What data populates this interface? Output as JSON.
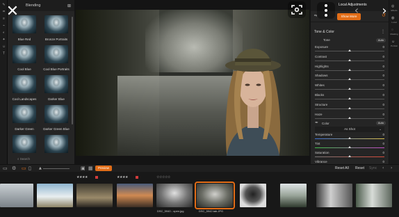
{
  "app": {
    "left_title": "Blending",
    "right_title_tab": "Local Adjustments"
  },
  "presets": [
    {
      "name": "Blue Red"
    },
    {
      "name": "Bronze Portraits"
    },
    {
      "name": "Cool Blue"
    },
    {
      "name": "Cool Blue Portraits"
    },
    {
      "name": "Cool Landscapes"
    },
    {
      "name": "Darker Blue"
    },
    {
      "name": "Darker Green"
    },
    {
      "name": "Darker Green Blue"
    },
    {
      "name": ""
    },
    {
      "name": ""
    }
  ],
  "search": {
    "placeholder": "Search"
  },
  "adjustments": {
    "show_more": "Show More",
    "section": "Tone & Color",
    "tone_label": "Tone",
    "auto": "Auto",
    "sliders": [
      {
        "label": "Exposure",
        "value": "0",
        "pos": 0.5
      },
      {
        "label": "Contrast",
        "value": "0",
        "pos": 0.5
      },
      {
        "label": "Highlights",
        "value": "0",
        "pos": 0.5
      },
      {
        "label": "Shadows",
        "value": "0",
        "pos": 0.5
      },
      {
        "label": "Whites",
        "value": "0",
        "pos": 0.5
      },
      {
        "label": "Blacks",
        "value": "0",
        "pos": 0.5
      },
      {
        "label": "Structure",
        "value": "0",
        "pos": 0.5
      },
      {
        "label": "Haze",
        "value": "0",
        "pos": 0.5
      }
    ],
    "color_label": "Color",
    "color_auto": "Auto",
    "white_balance": "As Shot",
    "color_sliders": [
      {
        "label": "Temperature",
        "value": "0",
        "pos": 0.5
      },
      {
        "label": "Tint",
        "value": "0",
        "pos": 0.5
      },
      {
        "label": "Saturation",
        "value": "0",
        "pos": 0.5
      },
      {
        "label": "Vibrance",
        "value": "0",
        "pos": 0.5
      }
    ]
  },
  "rightmost": [
    {
      "icon": "layers-icon",
      "label": "Effects"
    },
    {
      "icon": "sliders-icon",
      "label": "Local"
    },
    {
      "icon": "brush-icon",
      "label": "Masking"
    },
    {
      "icon": "person-icon",
      "label": "Portrait"
    }
  ],
  "bottom": {
    "preview": "Preview",
    "reset_all": "Reset All",
    "reset": "Reset",
    "sync": "Sync"
  },
  "filmstrip": [
    {
      "stars": "",
      "file": "",
      "flag": false
    },
    {
      "stars": "",
      "file": "",
      "flag": false
    },
    {
      "stars": "★★★★",
      "file": "",
      "flag": true
    },
    {
      "stars": "★★★★",
      "file": "",
      "flag": true
    },
    {
      "stars": "☆☆☆☆☆",
      "file": "DSC_5940 - open.jpg",
      "flag": false
    },
    {
      "stars": "",
      "file": "DSC_5942.tab.JPG",
      "flag": false
    },
    {
      "stars": "",
      "file": "",
      "flag": false
    },
    {
      "stars": "",
      "file": "",
      "flag": false
    },
    {
      "stars": "",
      "file": "",
      "flag": false
    },
    {
      "stars": "",
      "file": "",
      "flag": false
    }
  ],
  "colors": {
    "accent": "#e26d17",
    "panel": "#252525",
    "background": "#141414"
  }
}
